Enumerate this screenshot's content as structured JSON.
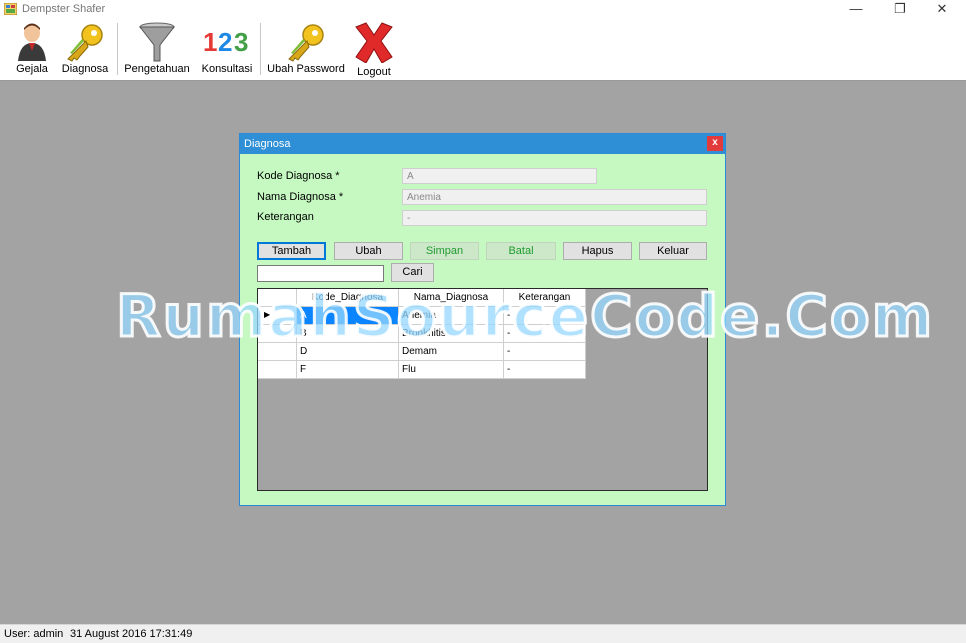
{
  "window": {
    "title": "Dempster Shafer",
    "minimize": "—",
    "restore": "❐",
    "close": "✕"
  },
  "toolbar": {
    "items": [
      {
        "label": "Gejala",
        "icon": "user-icon"
      },
      {
        "label": "Diagnosa",
        "icon": "keys-icon"
      },
      {
        "label": "Pengetahuan",
        "icon": "filter-icon"
      },
      {
        "label": "Konsultasi",
        "icon": "numbers-icon"
      },
      {
        "label": "Ubah Password",
        "icon": "keys-icon"
      },
      {
        "label": "Logout",
        "icon": "red-x-icon"
      }
    ]
  },
  "dialog": {
    "title": "Diagnosa",
    "close": "x",
    "fields": {
      "kode_label": "Kode Diagnosa *",
      "kode_value": "A",
      "nama_label": "Nama Diagnosa *",
      "nama_value": "Anemia",
      "ket_label": "Keterangan",
      "ket_value": "-"
    },
    "buttons": {
      "tambah": "Tambah",
      "ubah": "Ubah",
      "simpan": "Simpan",
      "batal": "Batal",
      "hapus": "Hapus",
      "keluar": "Keluar",
      "cari": "Cari"
    },
    "search_value": "",
    "grid": {
      "columns": [
        "Kode_Diagnosa",
        "Nama_Diagnosa",
        "Keterangan"
      ],
      "rows": [
        [
          "A",
          "Anemia",
          "-"
        ],
        [
          "B",
          "Bronkhitis",
          "-"
        ],
        [
          "D",
          "Demam",
          "-"
        ],
        [
          "F",
          "Flu",
          "-"
        ]
      ],
      "selected_row_marker": "▶"
    }
  },
  "watermark": "RumahSourceCode.Com",
  "status": {
    "user": "User: admin",
    "datetime": "31 August 2016 17:31:49"
  },
  "colors": {
    "dialog_bg": "#c5f9c1",
    "title_bar": "#2e8fd6",
    "selection": "#0a84ff",
    "close_red": "#e23b3b"
  }
}
